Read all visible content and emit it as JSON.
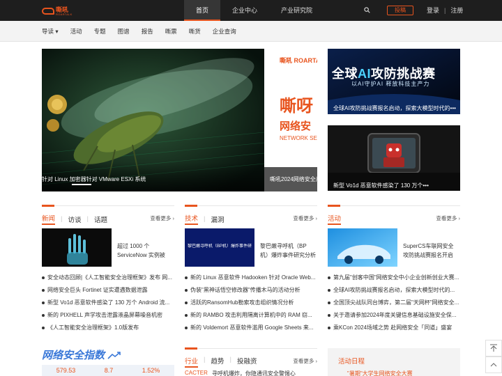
{
  "header": {
    "logo_cn": "嘶吼",
    "logo_en": "ROARTALK",
    "nav": [
      "首页",
      "企业中心",
      "产业研究院"
    ],
    "submit_label": "投稿",
    "login_label": "登录",
    "register_label": "注册"
  },
  "subnav": [
    "导读 ▾",
    "活动",
    "专题",
    "图谱",
    "报告",
    "嘶票",
    "嘶货",
    "企业查询"
  ],
  "hero": {
    "caption": "针对 Linux 加密器针对 VMware ESXi 系统",
    "promo_logo": "嘶吼 ROARTALK",
    "promo_big": "嘶呀",
    "promo_mid": "网络安",
    "promo_en": "NETWORK SE",
    "promo_caption": "嘶吼2024网络安全产"
  },
  "side": [
    {
      "title_pre": "全球",
      "title_ai": "AI",
      "title_post": "攻防挑战赛",
      "subtitle": "以AI守护AI 释放科技主产力",
      "caption": "全球AI攻防挑战赛报名启动，探索大模型时代的•••"
    },
    {
      "caption": "新型 Vo1d 恶意软件感染了 130 万个•••"
    }
  ],
  "columns": [
    {
      "tabs": [
        "新闻",
        "访谈",
        "话题"
      ],
      "more": "查看更多 ›",
      "feature": [
        "超过 1000 个",
        "ServiceNow 实例被"
      ],
      "items": [
        "安全动态回顾|《人工智能安全治理框架》发布 网...",
        "网络安全巨头 Fortinet 证实遭遇数据泄露",
        "新型 Vo1d 恶意软件感染了 130 万个 Android 流...",
        "新的 PIXHELL 声学攻击泄露液晶屏幕噪音机密",
        "《人工智能安全治理框架》1.0版发布"
      ]
    },
    {
      "tabs": [
        "技术",
        "漏洞"
      ],
      "more": "查看更多 ›",
      "feature_img_text": "黎巴嫩寻呼机（BP机）爆炸事件研究分析",
      "feature": [
        "黎巴嫩寻呼机（BP",
        "机）爆炸事件研究分析"
      ],
      "items": [
        "新的 Linux 恶意软件 Hadooken 针对 Oracle Web...",
        "伪装\"黑神话悟空修改器\"传播木马的活动分析",
        "活跃的RansomHub勒索攻击组织情况分析",
        "新的 RAMBO 攻击利用隔离计算机中的 RAM 窃...",
        "新的 Voldemort 恶意软件滥用 Google Sheets 来..."
      ]
    },
    {
      "tabs": [
        "活动"
      ],
      "more": "查看更多 ›",
      "feature": [
        "SuperCS车联网安全",
        "攻防挑战赛报名开启"
      ],
      "items": [
        "第九届\"创客中国\"网络安全中小企业创新创业大赛...",
        "全球AI攻防挑战赛报名启动，探索大模型时代的...",
        "全国顶尖战队同台博弈，第二届\"天网杯\"网络安全...",
        "关于邀请参加2024年度关键信息基础设施安全保...",
        "乘KCon 2024场域之势 赴网络安全「同道」盛宴"
      ]
    }
  ],
  "bottom": {
    "index_title": "网络安全指数",
    "index_values": [
      "579.53",
      "8.7",
      "1.52%"
    ],
    "col2_tabs": [
      "行业",
      "趋势",
      "投融资"
    ],
    "col2_more": "查看更多 ›",
    "col2_label": "CACTER",
    "col2_text": "寻呼机爆炸，你隐通讯安全警惕心",
    "events_title": "活动日程",
    "events_peek": "\"暑期\"大学生网络安全大赛"
  },
  "colors": {
    "accent": "#e8541e",
    "topbar": "#1e1e1e",
    "index_blue": "#3a78d8"
  }
}
